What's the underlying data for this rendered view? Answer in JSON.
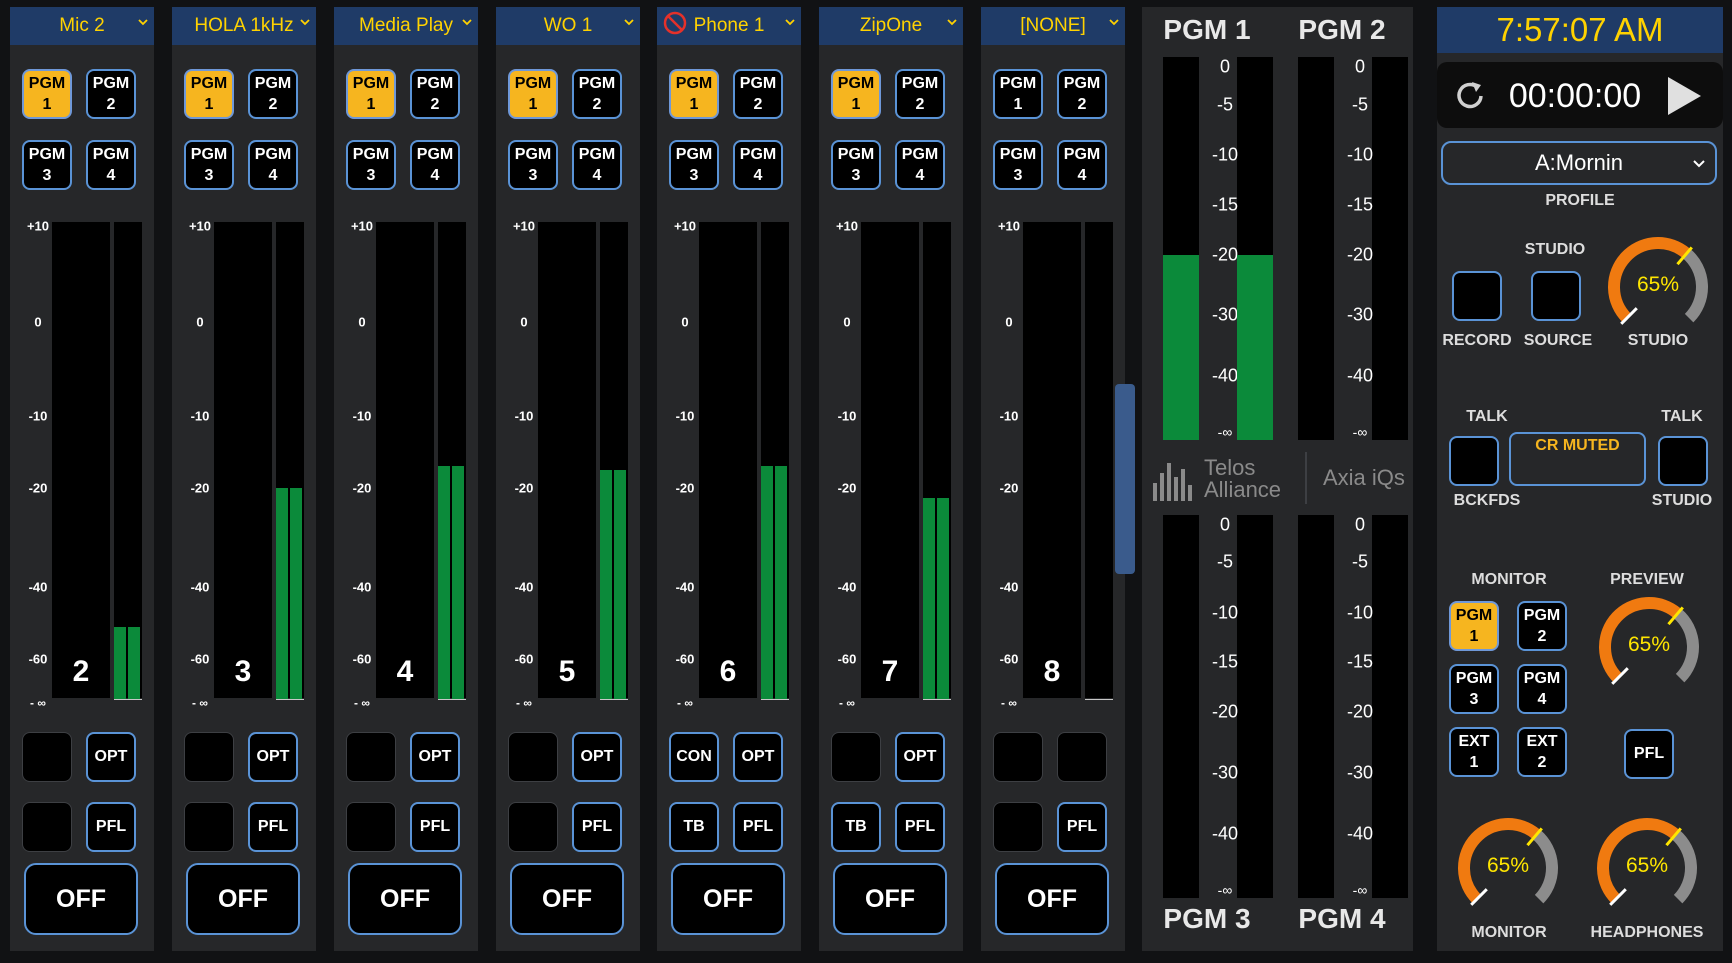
{
  "channels": [
    {
      "name": "Mic 2",
      "number": "2",
      "pgm_on": [
        true,
        false,
        false,
        false
      ],
      "btn_a1": "",
      "btn_b1": "OPT",
      "btn_a2": "",
      "btn_b2": "PFL",
      "off": "OFF",
      "level_db": -51,
      "phone_blocked": false
    },
    {
      "name": "HOLA 1kHz",
      "number": "3",
      "pgm_on": [
        true,
        false,
        false,
        false
      ],
      "btn_a1": "",
      "btn_b1": "OPT",
      "btn_a2": "",
      "btn_b2": "PFL",
      "off": "OFF",
      "level_db": -20,
      "phone_blocked": false
    },
    {
      "name": "Media Play",
      "number": "4",
      "pgm_on": [
        true,
        false,
        false,
        false
      ],
      "btn_a1": "",
      "btn_b1": "OPT",
      "btn_a2": "",
      "btn_b2": "PFL",
      "off": "OFF",
      "level_db": -17,
      "phone_blocked": false
    },
    {
      "name": "WO 1",
      "number": "5",
      "pgm_on": [
        true,
        false,
        false,
        false
      ],
      "btn_a1": "",
      "btn_b1": "OPT",
      "btn_a2": "",
      "btn_b2": "PFL",
      "off": "OFF",
      "level_db": -17.5,
      "phone_blocked": false
    },
    {
      "name": "Phone 1",
      "number": "6",
      "pgm_on": [
        true,
        false,
        false,
        false
      ],
      "btn_a1": "CON",
      "btn_b1": "OPT",
      "btn_a2": "TB",
      "btn_b2": "PFL",
      "off": "OFF",
      "level_db": -17,
      "phone_blocked": true
    },
    {
      "name": "ZipOne",
      "number": "7",
      "pgm_on": [
        true,
        false,
        false,
        false
      ],
      "btn_a1": "",
      "btn_b1": "OPT",
      "btn_a2": "TB",
      "btn_b2": "PFL",
      "off": "OFF",
      "level_db": -22,
      "phone_blocked": false
    },
    {
      "name": "[NONE]",
      "number": "8",
      "pgm_on": [
        false,
        false,
        false,
        false
      ],
      "btn_a1": "",
      "btn_b1": "",
      "btn_a2": "",
      "btn_b2": "PFL",
      "off": "OFF",
      "level_db": null,
      "phone_blocked": false
    }
  ],
  "pgm_lines": [
    [
      "PGM",
      "1"
    ],
    [
      "PGM",
      "2"
    ],
    [
      "PGM",
      "3"
    ],
    [
      "PGM",
      "4"
    ]
  ],
  "fader_scale": [
    "+10",
    "0",
    "-10",
    "-20",
    "-40",
    "-60",
    "- ∞"
  ],
  "pgm_meters": {
    "titles": [
      "PGM 1",
      "PGM 2",
      "PGM 3",
      "PGM 4"
    ],
    "scale": [
      "0",
      "-5",
      "-10",
      "-15",
      "-20",
      "-30",
      "-40",
      "-∞"
    ],
    "levels_db": [
      -20,
      null,
      null,
      null
    ]
  },
  "logos": {
    "telos_line1": "Telos",
    "telos_line2": "Alliance",
    "axia": "Axia iQs"
  },
  "right": {
    "clock": "7:57:07 AM",
    "timer": "00:00:00",
    "profile_value": "A:Mornin",
    "profile_label": "PROFILE",
    "studio_label": "STUDIO",
    "record_label": "RECORD",
    "source_label": "SOURCE",
    "studio_knob_label": "STUDIO",
    "studio_level": "65%",
    "talk_left": "TALK",
    "talk_right": "TALK",
    "cr_muted": "CR MUTED",
    "bckfds": "BCKFDS",
    "talk_studio": "STUDIO",
    "monitor_label": "MONITOR",
    "preview_label": "PREVIEW",
    "monitor_buttons": [
      [
        "PGM",
        "1"
      ],
      [
        "PGM",
        "2"
      ],
      [
        "PGM",
        "3"
      ],
      [
        "PGM",
        "4"
      ],
      [
        "EXT",
        "1"
      ],
      [
        "EXT",
        "2"
      ]
    ],
    "preview_level": "65%",
    "pfl": "PFL",
    "monitor_level": "65%",
    "headphones_level": "65%",
    "monitor_knob_label": "MONITOR",
    "headphones_knob_label": "HEADPHONES"
  },
  "colors": {
    "accent_yellow": "#f6b51f",
    "meter_green": "#0b8a3a",
    "button_border": "#5a93d6",
    "header_blue": "#1f3b67",
    "knob_orange": "#f07a10"
  }
}
